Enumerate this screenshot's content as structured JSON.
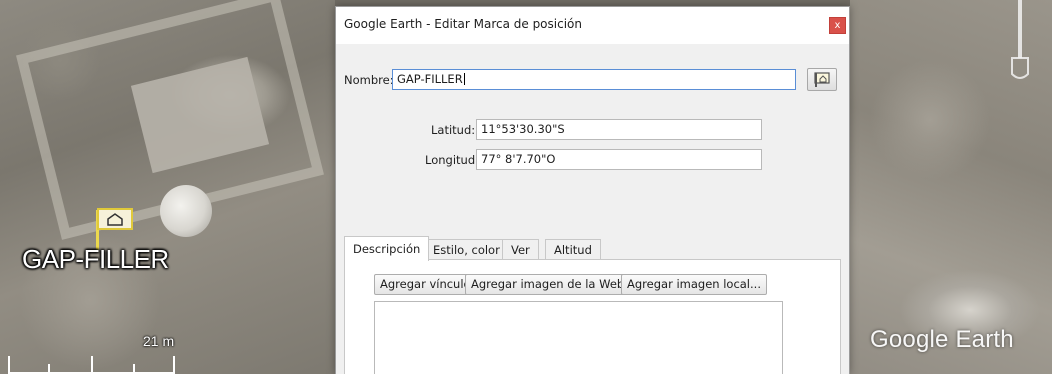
{
  "map": {
    "placemark_label": "GAP-FILLER",
    "scale_label": "21 m",
    "watermark": "Google Earth"
  },
  "dialog": {
    "title": "Google Earth - Editar Marca de posición",
    "close_label": "x",
    "name": {
      "label": "Nombre:",
      "value": "GAP-FILLER"
    },
    "latitude": {
      "label": "Latitud:",
      "value": "11°53'30.30\"S"
    },
    "longitude": {
      "label": "Longitud:",
      "value": "77° 8'7.70\"O"
    },
    "icon_button_icon": "placemark-icon",
    "tabs": [
      {
        "label": "Descripción",
        "active": true
      },
      {
        "label": "Estilo, color",
        "active": false
      },
      {
        "label": "Ver",
        "active": false
      },
      {
        "label": "Altitud",
        "active": false
      }
    ],
    "description_buttons": [
      {
        "label": "Agregar vínculo"
      },
      {
        "label": "Agregar imagen de la Web..."
      },
      {
        "label": "Agregar imagen local..."
      }
    ],
    "description_text": ""
  }
}
